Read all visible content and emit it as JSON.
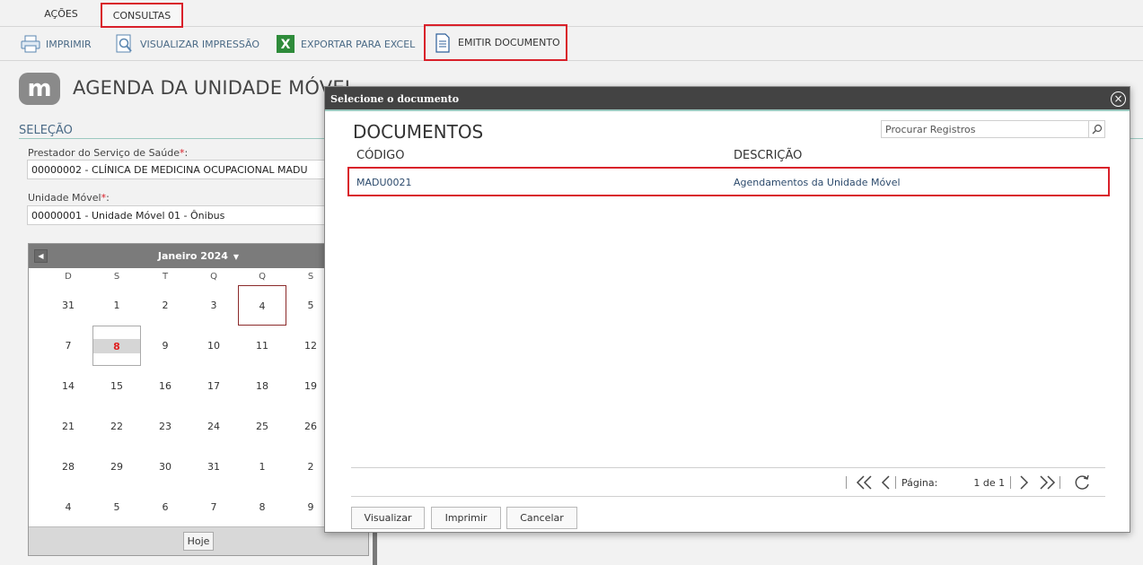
{
  "menu": {
    "acoes": "AÇÕES",
    "consultas": "CONSULTAS"
  },
  "toolbar": {
    "imprimir": "IMPRIMIR",
    "visualizar": "VISUALIZAR IMPRESSÃO",
    "exportar": "EXPORTAR PARA EXCEL",
    "emitir": "EMITIR DOCUMENTO"
  },
  "page": {
    "logo_letter": "m",
    "title": "AGENDA DA UNIDADE MÓVEL",
    "section": "SELEÇÃO",
    "prestador_label": "Prestador do Serviço de Saúde",
    "prestador_value": "00000002 - CLÍNICA DE MEDICINA OCUPACIONAL MADU",
    "unidade_label": "Unidade Móvel",
    "unidade_value": "00000001 - Unidade Móvel 01 - Ônibus",
    "required_mark": "*",
    "colon": ":"
  },
  "calendar": {
    "month": "Janeiro 2024",
    "weekdays": [
      "D",
      "S",
      "T",
      "Q",
      "Q",
      "S"
    ],
    "weeks": [
      [
        "31",
        "1",
        "2",
        "3",
        "4",
        "5"
      ],
      [
        "7",
        "8",
        "9",
        "10",
        "11",
        "12"
      ],
      [
        "14",
        "15",
        "16",
        "17",
        "18",
        "19"
      ],
      [
        "21",
        "22",
        "23",
        "24",
        "25",
        "26"
      ],
      [
        "28",
        "29",
        "30",
        "31",
        "1",
        "2"
      ],
      [
        "4",
        "5",
        "6",
        "7",
        "8",
        "9"
      ]
    ],
    "today_label": "Hoje"
  },
  "modal": {
    "title": "Selecione o documento",
    "heading": "DOCUMENTOS",
    "search_placeholder": "Procurar Registros",
    "columns": {
      "codigo": "CÓDIGO",
      "descricao": "DESCRIÇÃO"
    },
    "rows": [
      {
        "codigo": "MADU0021",
        "descricao": "Agendamentos da Unidade Móvel"
      }
    ],
    "pager": {
      "label": "Página:",
      "value": "1 de 1"
    },
    "buttons": {
      "visualizar": "Visualizar",
      "imprimir": "Imprimir",
      "cancelar": "Cancelar"
    }
  }
}
